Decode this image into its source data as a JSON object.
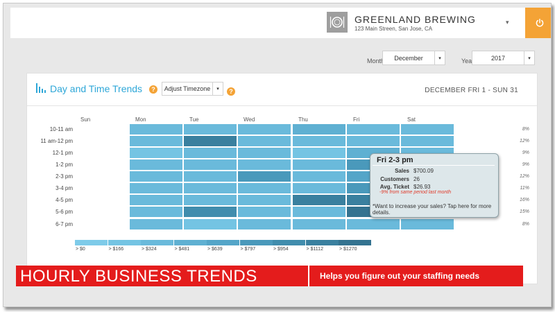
{
  "header": {
    "business_name": "GREENLAND BREWING",
    "business_address": "123 Main Streen, San Jose, CA",
    "logo_icon": "plate-cutlery-icon",
    "account_chevron": "▾",
    "power_icon": "power-icon",
    "accent_color": "#f4a336"
  },
  "filters": {
    "month_label": "Month",
    "month_value": "December",
    "year_label": "Year",
    "year_value": "2017",
    "dropdown_arrow": "▾"
  },
  "card": {
    "title": "Day and Time Trends",
    "help_glyph": "?",
    "timezone_button": "Adjust Timezone",
    "date_range": "DECEMBER FRI 1 - SUN 31",
    "title_color": "#2ea7d8"
  },
  "heatmap": {
    "days": [
      "Sun",
      "Mon",
      "Tue",
      "Wed",
      "Thu",
      "Fri",
      "Sat"
    ],
    "hours": [
      "10-11 am",
      "11 am-12 pm",
      "12-1 pm",
      "1-2 pm",
      "2-3 pm",
      "3-4 pm",
      "4-5 pm",
      "5-6 pm",
      "6-7 pm"
    ],
    "row_percents": [
      "8%",
      "12%",
      "9%",
      "9%",
      "12%",
      "11%",
      "16%",
      "15%",
      "8%"
    ],
    "levels": [
      [
        null,
        2,
        2,
        2,
        3,
        2,
        2
      ],
      [
        null,
        2,
        7,
        2,
        2,
        2,
        2
      ],
      [
        null,
        1,
        2,
        2,
        1,
        3,
        2
      ],
      [
        null,
        2,
        2,
        2,
        2,
        5,
        2
      ],
      [
        null,
        2,
        2,
        5,
        2,
        4,
        2
      ],
      [
        null,
        2,
        2,
        2,
        2,
        5,
        2
      ],
      [
        null,
        2,
        2,
        2,
        7,
        7,
        2
      ],
      [
        null,
        2,
        6,
        2,
        2,
        8,
        2
      ],
      [
        null,
        2,
        1,
        2,
        2,
        2,
        2
      ]
    ],
    "colors": [
      "#7ecbe9",
      "#74c4e3",
      "#6abadb",
      "#5fb0d2",
      "#54a5c8",
      "#4a99bb",
      "#418dad",
      "#3a809f",
      "#347390"
    ],
    "legend": [
      "> $0",
      "> $166",
      "> $324",
      "> $481",
      "> $639",
      "> $797",
      "> $954",
      "> $1112",
      "> $1270"
    ]
  },
  "tooltip": {
    "title": "Fri 2-3 pm",
    "rows": [
      {
        "key": "Sales",
        "value": "$700.09"
      },
      {
        "key": "Customers",
        "value": "26"
      },
      {
        "key": "Avg. Ticket",
        "value": "$26.93"
      }
    ],
    "note": "-9% from same period last month",
    "cta": "*Want to increase your sales? Tap here for more details."
  },
  "banner": {
    "main": "HOURLY BUSINESS TRENDS",
    "sub": "Helps you figure out your staffing needs",
    "color": "#e41c1c"
  }
}
